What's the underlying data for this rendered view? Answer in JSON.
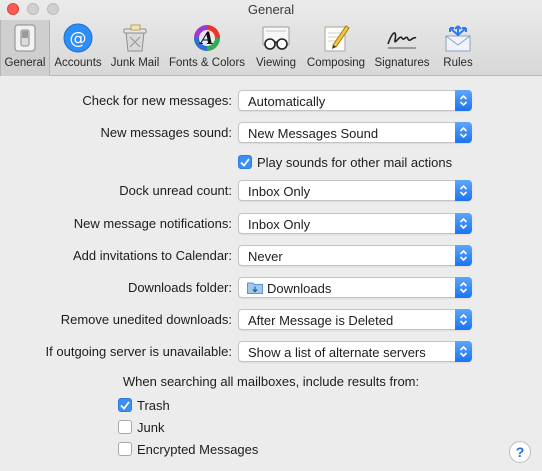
{
  "window": {
    "title": "General"
  },
  "toolbar": {
    "items": [
      {
        "label": "General",
        "icon": "general-switch-icon",
        "selected": true
      },
      {
        "label": "Accounts",
        "icon": "at-sign-icon"
      },
      {
        "label": "Junk Mail",
        "icon": "trash-can-icon"
      },
      {
        "label": "Fonts & Colors",
        "icon": "font-color-wheel-icon"
      },
      {
        "label": "Viewing",
        "icon": "eyeglasses-icon"
      },
      {
        "label": "Composing",
        "icon": "pencil-paper-icon"
      },
      {
        "label": "Signatures",
        "icon": "signature-icon"
      },
      {
        "label": "Rules",
        "icon": "envelope-arrows-icon"
      }
    ]
  },
  "settings": {
    "check_new_messages": {
      "label": "Check for new messages:",
      "value": "Automatically"
    },
    "new_messages_sound": {
      "label": "New messages sound:",
      "value": "New Messages Sound"
    },
    "play_sounds": {
      "label": "Play sounds for other mail actions",
      "checked": true
    },
    "dock_unread": {
      "label": "Dock unread count:",
      "value": "Inbox Only"
    },
    "notifications": {
      "label": "New message notifications:",
      "value": "Inbox Only"
    },
    "invitations": {
      "label": "Add invitations to Calendar:",
      "value": "Never"
    },
    "downloads_folder": {
      "label": "Downloads folder:",
      "value": "Downloads"
    },
    "remove_downloads": {
      "label": "Remove unedited downloads:",
      "value": "After Message is Deleted"
    },
    "outgoing_server": {
      "label": "If outgoing server is unavailable:",
      "value": "Show a list of alternate servers"
    }
  },
  "search": {
    "title": "When searching all mailboxes, include results from:",
    "options": [
      {
        "label": "Trash",
        "checked": true
      },
      {
        "label": "Junk",
        "checked": false
      },
      {
        "label": "Encrypted Messages",
        "checked": false
      }
    ]
  },
  "help": {
    "label": "?"
  },
  "colors": {
    "accent": "#3a8ef5",
    "close": "#fc5b57"
  }
}
